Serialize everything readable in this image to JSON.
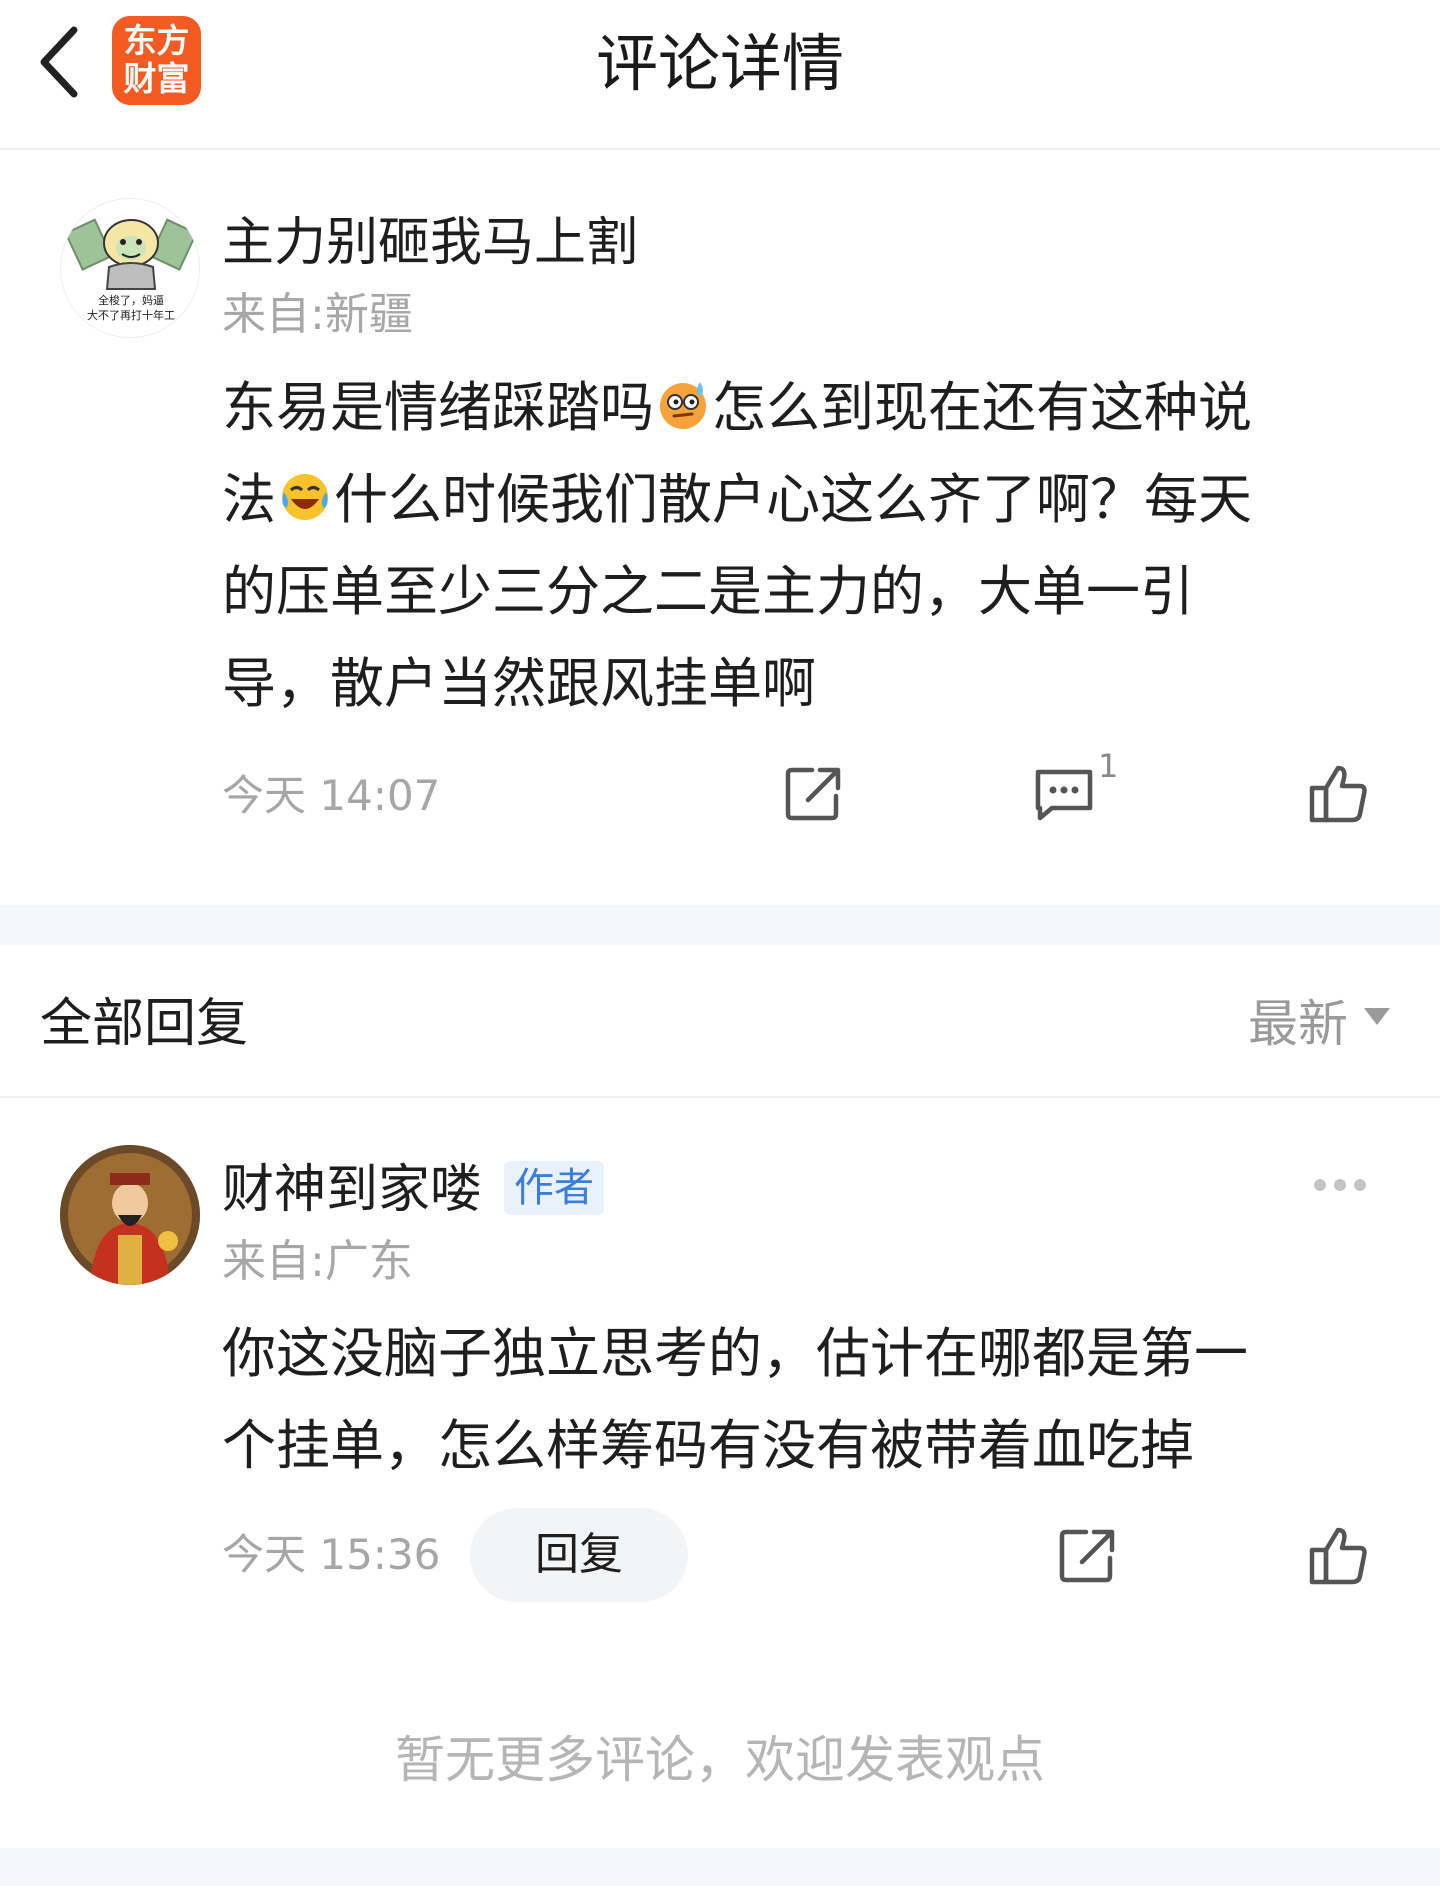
{
  "header": {
    "title": "评论详情",
    "logo_line1": "东方",
    "logo_line2": "财富",
    "brand_color": "#f35b22"
  },
  "main_comment": {
    "username": "主力别砸我马上割",
    "location": "来自:新疆",
    "avatar_caption_line1": "全梭了，妈逼",
    "avatar_caption_line2": "大不了再打十年工",
    "lines": [
      [
        "东易是情绪踩踏吗",
        "emoji-thinking-sweat",
        "怎么到现在还有这种说"
      ],
      [
        "法",
        "emoji-laugh-cry",
        "什么时候我们散户心这么齐了啊？每天"
      ],
      [
        "的压单至少三分之二是主力的，大单一引"
      ],
      [
        "导，散户当然跟风挂单啊"
      ]
    ],
    "timestamp": "今天 14:07",
    "reply_count": "1",
    "icons": [
      "share-icon",
      "comment-icon",
      "thumbs-up-icon"
    ]
  },
  "replies_section": {
    "title": "全部回复",
    "sort_label": "最新"
  },
  "reply": {
    "username": "财神到家喽",
    "badge": "作者",
    "badge_color": "#3a7fdc",
    "location": "来自:广东",
    "lines": [
      "你这没脑子独立思考的，估计在哪都是第一",
      "个挂单，怎么样筹码有没有被带着血吃掉"
    ],
    "timestamp": "今天 15:36",
    "reply_button": "回复",
    "icons": [
      "more-icon",
      "share-icon",
      "thumbs-up-icon"
    ]
  },
  "footer": {
    "end_text": "暂无更多评论，欢迎发表观点"
  }
}
